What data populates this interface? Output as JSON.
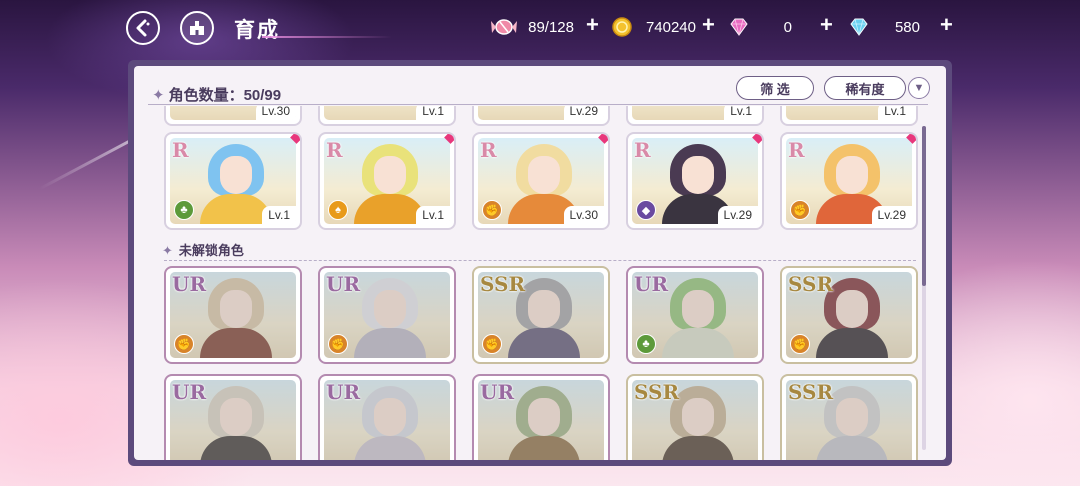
{
  "header": {
    "title": "育成",
    "back_label": "<",
    "resources": [
      {
        "name": "stamina",
        "icon": "candy-icon",
        "value": "89/128"
      },
      {
        "name": "gold",
        "icon": "coin-icon",
        "value": "740240"
      },
      {
        "name": "gem_pink",
        "icon": "pink-diamond-icon",
        "value": "0"
      },
      {
        "name": "gem_blue",
        "icon": "blue-diamond-icon",
        "value": "580"
      }
    ]
  },
  "panel": {
    "count_label": "角色数量：50/99",
    "filter_label": "筛 选",
    "rarity_label": "稀有度",
    "top_row_levels": [
      "Lv.30",
      "Lv.1",
      "Lv.29",
      "Lv.1",
      "Lv.1"
    ],
    "owned_cards": [
      {
        "rarity": "R",
        "level": "Lv.1",
        "element": "grass",
        "hair": "#7fc3f0",
        "outfit": "#f2c24a"
      },
      {
        "rarity": "R",
        "level": "Lv.1",
        "element": "fire",
        "hair": "#e9e27a",
        "outfit": "#e9a12a"
      },
      {
        "rarity": "R",
        "level": "Lv.30",
        "element": "earth",
        "hair": "#f1dca0",
        "outfit": "#e68a3a"
      },
      {
        "rarity": "R",
        "level": "Lv.29",
        "element": "dark",
        "hair": "#4a3a52",
        "outfit": "#3a3440"
      },
      {
        "rarity": "R",
        "level": "Lv.29",
        "element": "earth",
        "hair": "#f4c26a",
        "outfit": "#e0663a"
      }
    ],
    "locked_section_label": "未解锁角色",
    "locked_cards_row1": [
      {
        "rarity": "UR",
        "element": "earth",
        "hair": "#d8c4a4",
        "outfit": "#7a3a2a"
      },
      {
        "rarity": "UR",
        "element": "earth",
        "hair": "#e4e4ea",
        "outfit": "#b8b4c4"
      },
      {
        "rarity": "SSR",
        "element": "earth",
        "hair": "#a0a0a4",
        "outfit": "#5a5070"
      },
      {
        "rarity": "UR",
        "element": "grass",
        "hair": "#8cc070",
        "outfit": "#d8dcc8"
      },
      {
        "rarity": "SSR",
        "element": "earth",
        "hair": "#7a2a30",
        "outfit": "#2a2228"
      }
    ],
    "locked_cards_row2": [
      {
        "rarity": "UR",
        "hair": "#d8d0c0",
        "outfit": "#3a3430"
      },
      {
        "rarity": "UR",
        "hair": "#d4d8e0",
        "outfit": "#c8c0cc"
      },
      {
        "rarity": "UR",
        "hair": "#9cb080",
        "outfit": "#8a6a40"
      },
      {
        "rarity": "SSR",
        "hair": "#c4b090",
        "outfit": "#4a3a2c"
      },
      {
        "rarity": "SSR",
        "hair": "#d0d0d0",
        "outfit": "#c0c0c8"
      }
    ]
  },
  "colors": {
    "panel_border": "#5c4a7c",
    "panel_bg": "#f6f2f7",
    "element_grass": "#5d9a3a",
    "element_fire": "#e89a1a",
    "element_earth": "#d8842a",
    "element_dark": "#6a4aa0",
    "gem_badge": "#e8377c"
  }
}
